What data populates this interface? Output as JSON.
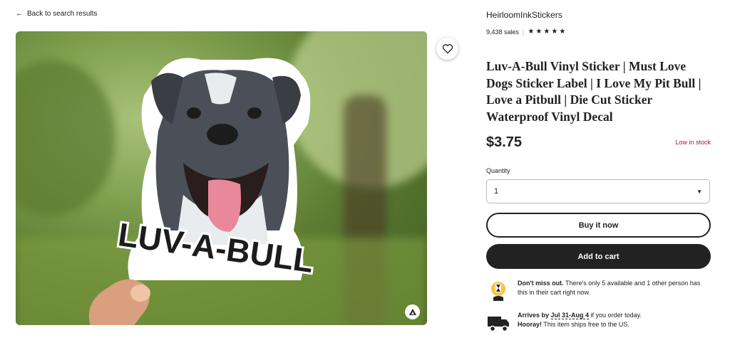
{
  "nav": {
    "back_label": "Back to search results"
  },
  "shop": {
    "name": "HeirloomInkStickers",
    "sales": "9,438 sales",
    "rating_stars": 5
  },
  "listing": {
    "title": "Luv-A-Bull Vinyl Sticker | Must Love Dogs Sticker Label | I Love My Pit Bull | Love a Pitbull | Die Cut Sticker Waterproof Vinyl Decal",
    "price": "$3.75",
    "stock_status": "Low in stock",
    "sticker_text": "LUV-A-BULL"
  },
  "quantity": {
    "label": "Quantity",
    "selected": "1"
  },
  "actions": {
    "buy_now": "Buy it now",
    "add_to_cart": "Add to cart"
  },
  "notices": {
    "scarcity_bold": "Don't miss out.",
    "scarcity_text": " There's only 5 available and 1 other person has this in their cart right now.",
    "arrives_bold": "Arrives by ",
    "arrives_dates": "Jul 31-Aug 4",
    "arrives_text": " if you order today.",
    "hooray_bold": "Hooray!",
    "hooray_text": " This item ships free to the US."
  },
  "colors": {
    "stock_red": "#a61a2e",
    "button_dark": "#222222",
    "sticker_pink": "#e8889a"
  },
  "icons": {
    "back": "arrow-left-icon",
    "favorite": "heart-icon",
    "zoom": "expand-icon",
    "scarcity": "hourglass-icon",
    "shipping": "truck-icon"
  }
}
